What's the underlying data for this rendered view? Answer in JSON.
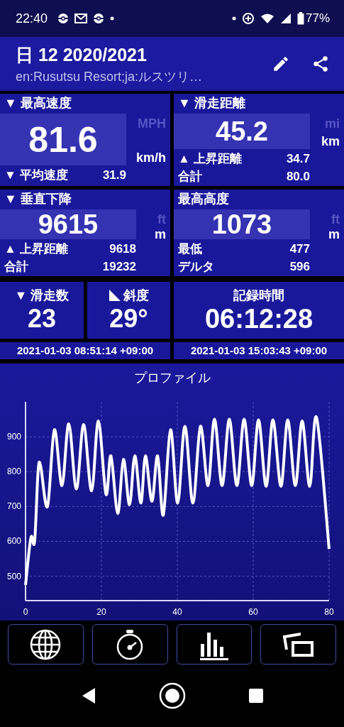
{
  "status_bar": {
    "time": "22:40",
    "battery": "77%"
  },
  "header": {
    "title": "日 12 2020/2021",
    "subtitle": "en:Rusutsu Resort;ja:ルスツリ…"
  },
  "panels": [
    {
      "label": "▼ 最高速度",
      "value": "81.6",
      "units": [
        {
          "label": "MPH",
          "selected": false
        },
        {
          "label": "km/h",
          "selected": true
        }
      ],
      "rows": [
        {
          "label": "▼ 平均速度",
          "value": "31.9"
        }
      ]
    },
    {
      "label": "▼ 滑走距離",
      "value": "45.2",
      "units": [
        {
          "label": "mi",
          "selected": false
        },
        {
          "label": "km",
          "selected": true
        }
      ],
      "rows": [
        {
          "label": "▲ 上昇距離",
          "value": "34.7"
        },
        {
          "label": "合計",
          "value": "80.0"
        }
      ]
    },
    {
      "label": "▼ 垂直下降",
      "value": "9615",
      "units": [
        {
          "label": "ft",
          "selected": false
        },
        {
          "label": "m",
          "selected": true
        }
      ],
      "rows": [
        {
          "label": "▲ 上昇距離",
          "value": "9618"
        },
        {
          "label": "合計",
          "value": "19232"
        }
      ]
    },
    {
      "label": "最高高度",
      "value": "1073",
      "units": [
        {
          "label": "ft",
          "selected": false
        },
        {
          "label": "m",
          "selected": true
        }
      ],
      "rows": [
        {
          "label": "最低",
          "value": "477"
        },
        {
          "label": "デルタ",
          "value": "596"
        }
      ]
    }
  ],
  "summary": [
    {
      "kind": "count",
      "label": "▼ 滑走数",
      "value": "23"
    },
    {
      "kind": "slope",
      "label": "斜度",
      "value": "29°"
    },
    {
      "kind": "time",
      "label": "記録時間",
      "value": "06:12:28"
    }
  ],
  "dates": [
    "2021-01-03 08:51:14 +09:00",
    "2021-01-03 15:03:43 +09:00"
  ],
  "chart": {
    "title": "プロファイル",
    "chart_data": {
      "type": "line",
      "grid": true,
      "xlim": [
        0,
        80
      ],
      "ylim": [
        430,
        1000
      ],
      "xticks": [
        0,
        20,
        40,
        60,
        80
      ],
      "yticks": [
        500,
        600,
        700,
        800,
        900
      ],
      "x": [
        0,
        1.4,
        2.4,
        3.3,
        4.0,
        5.8,
        7.6,
        9.6,
        11.4,
        13.4,
        15.3,
        17.4,
        19.2,
        21.2,
        22.5,
        24.3,
        25.8,
        27.4,
        28.8,
        30.4,
        31.6,
        33.3,
        34.8,
        36.3,
        38.2,
        40.1,
        42.0,
        44.1,
        46.1,
        48.1,
        49.8,
        51.8,
        53.7,
        55.7,
        57.6,
        59.6,
        61.4,
        63.4,
        65.2,
        67.3,
        69.1,
        71.1,
        72.9,
        74.9,
        76.7,
        80
      ],
      "values": [
        475,
        610,
        600,
        800,
        815,
        700,
        920,
        760,
        937,
        750,
        935,
        745,
        945,
        735,
        845,
        680,
        835,
        705,
        845,
        710,
        845,
        715,
        845,
        675,
        920,
        710,
        930,
        710,
        930,
        760,
        950,
        760,
        950,
        760,
        950,
        760,
        948,
        758,
        948,
        758,
        948,
        760,
        945,
        758,
        955,
        578
      ]
    }
  }
}
